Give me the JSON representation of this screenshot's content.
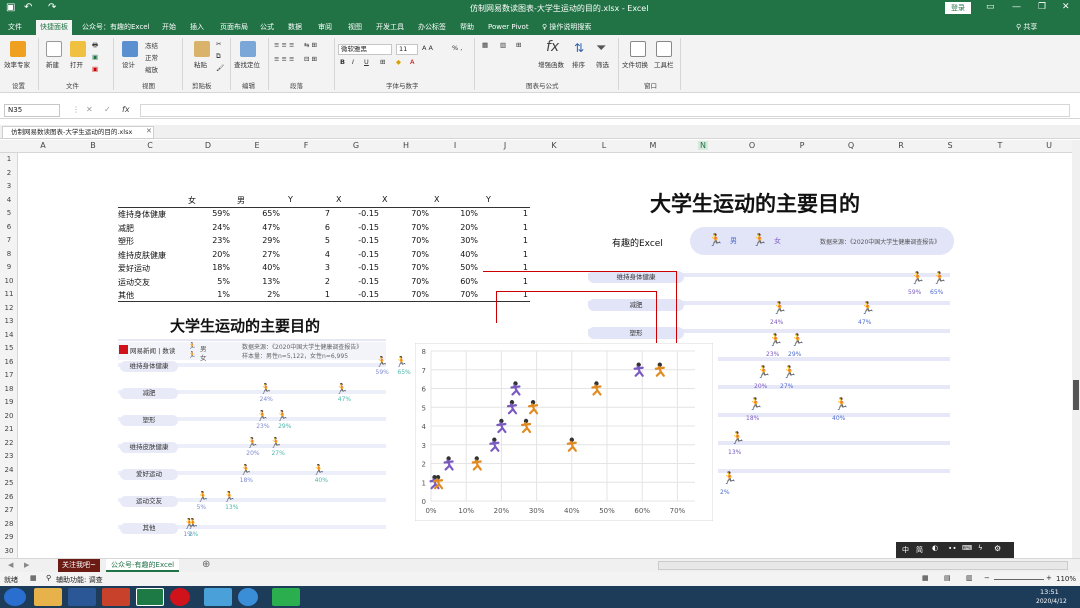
{
  "window": {
    "title": "仿制网易数读图表-大学生运动的目的.xlsx - Excel",
    "login": "登录",
    "share": "共享"
  },
  "ribbon_tabs": [
    "文件",
    "快捷面板",
    "公众号：有趣的Excel",
    "开始",
    "插入",
    "页面布局",
    "公式",
    "数据",
    "审阅",
    "视图",
    "开发工具",
    "办公标签",
    "帮助",
    "Power Pivot",
    "操作说明搜索"
  ],
  "ribbon": {
    "buttons": [
      "效率专家",
      "新建",
      "打开",
      "设计",
      "文件",
      "视图",
      "粘贴",
      "查找定位",
      "增强函数",
      "排序",
      "筛选",
      "文件切换",
      "工具栏"
    ],
    "small": [
      "冻结",
      "正常",
      "缩放"
    ],
    "font": "微软雅黑",
    "size": "11",
    "groups": [
      "设置",
      "文件",
      "视图",
      "剪贴板",
      "编辑",
      "段落",
      "字体与数字",
      "排序",
      "图表与公式",
      "窗口"
    ]
  },
  "formula_bar": {
    "name_box": "N35",
    "fx": "fx"
  },
  "file_tab": "仿制网易数读图表-大学生运动的目的.xlsx",
  "columns": [
    "A",
    "B",
    "C",
    "D",
    "E",
    "F",
    "G",
    "H",
    "I",
    "J",
    "K",
    "L",
    "M",
    "N",
    "O",
    "P",
    "Q",
    "R",
    "S",
    "T",
    "U"
  ],
  "rows": [
    "1",
    "2",
    "3",
    "4",
    "5",
    "6",
    "7",
    "8",
    "9",
    "10",
    "11",
    "12",
    "13",
    "14",
    "15",
    "16",
    "17",
    "18",
    "19",
    "20",
    "21",
    "22",
    "23",
    "24",
    "25",
    "26",
    "27",
    "28",
    "29",
    "30"
  ],
  "table": {
    "headers": [
      "女",
      "男",
      "Y",
      "X",
      "X",
      "X",
      "Y"
    ],
    "rows": [
      [
        "维持身体健康",
        "59%",
        "65%",
        "7",
        "-0.15",
        "70%",
        "10%",
        "1"
      ],
      [
        "减肥",
        "24%",
        "47%",
        "6",
        "-0.15",
        "70%",
        "20%",
        "1"
      ],
      [
        "塑形",
        "23%",
        "29%",
        "5",
        "-0.15",
        "70%",
        "30%",
        "1"
      ],
      [
        "维持皮肤健康",
        "20%",
        "27%",
        "4",
        "-0.15",
        "70%",
        "40%",
        "1"
      ],
      [
        "爱好运动",
        "18%",
        "40%",
        "3",
        "-0.15",
        "70%",
        "50%",
        "1"
      ],
      [
        "运动交友",
        "5%",
        "13%",
        "2",
        "-0.15",
        "70%",
        "60%",
        "1"
      ],
      [
        "其他",
        "1%",
        "2%",
        "1",
        "-0.15",
        "70%",
        "70%",
        "1"
      ]
    ]
  },
  "infographic_left": {
    "title": "大学生运动的主要目的",
    "brand": "网易新闻 | 数读",
    "legend_male": "男",
    "legend_female": "女",
    "source": "数据来源：《2020中国大学生健康调查报告》",
    "sample": "样本量：男性n=5,122，女性n=6,995",
    "categories": [
      "维持身体健康",
      "减肥",
      "塑形",
      "维持皮肤健康",
      "爱好运动",
      "运动交友",
      "其他"
    ],
    "female": [
      "59%",
      "24%",
      "23%",
      "20%",
      "18%",
      "5%",
      "1%"
    ],
    "male": [
      "65%",
      "47%",
      "29%",
      "27%",
      "40%",
      "13%",
      "2%"
    ]
  },
  "infographic_right": {
    "title": "大学生运动的主要目的",
    "subtitle": "有趣的Excel",
    "legend_male": "男",
    "legend_female": "女",
    "source": "数据来源：《2020中国大学生健康调查报告》",
    "categories": [
      "维持身体健康",
      "减肥",
      "塑形"
    ],
    "labels": [
      "59%",
      "65%",
      "24%",
      "47%",
      "23%",
      "29%",
      "20%",
      "27%",
      "18%",
      "40%",
      "13%",
      "2%"
    ]
  },
  "chart_data": {
    "type": "scatter",
    "x_ticks": [
      "0%",
      "10%",
      "20%",
      "30%",
      "40%",
      "50%",
      "60%",
      "70%"
    ],
    "y_ticks": [
      "0",
      "1",
      "2",
      "3",
      "4",
      "5",
      "6",
      "7",
      "8"
    ],
    "xlim": [
      0,
      0.75
    ],
    "ylim": [
      0,
      8
    ],
    "series": [
      {
        "name": "女",
        "x": [
          0.59,
          0.24,
          0.23,
          0.2,
          0.18,
          0.05,
          0.01
        ],
        "y": [
          7,
          6,
          5,
          4,
          3,
          2,
          1
        ]
      },
      {
        "name": "男",
        "x": [
          0.65,
          0.47,
          0.29,
          0.27,
          0.4,
          0.13,
          0.02
        ],
        "y": [
          7,
          6,
          5,
          4,
          3,
          2,
          1
        ]
      }
    ]
  },
  "float_toolbar": [
    "中",
    "简"
  ],
  "sheet_tabs": [
    "关注我吧~",
    "公众号-有趣的Excel"
  ],
  "status": {
    "ready": "就绪",
    "accessibility": "辅助功能: 调查",
    "zoom": "110%",
    "time": "13:51",
    "date": "2020/4/12"
  }
}
